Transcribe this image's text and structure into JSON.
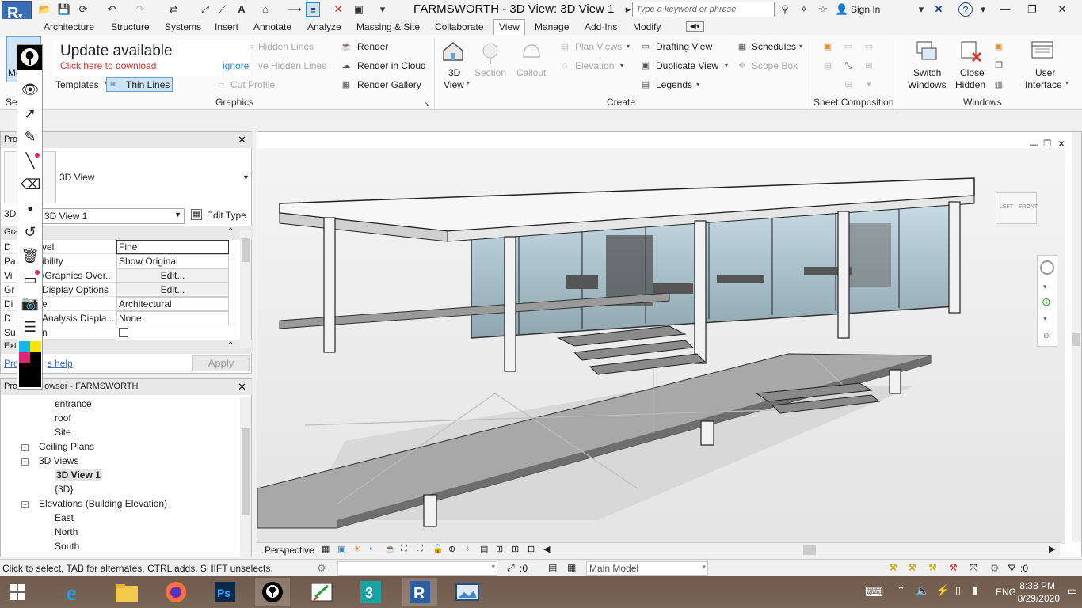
{
  "app": {
    "logo_letter": "R",
    "title": "FARMSWORTH - 3D View: 3D View 1",
    "search_placeholder": "Type a keyword or phrase",
    "sign_in": "Sign In"
  },
  "tabs": [
    {
      "label": "Architecture"
    },
    {
      "label": "Structure"
    },
    {
      "label": "Systems"
    },
    {
      "label": "Insert"
    },
    {
      "label": "Annotate"
    },
    {
      "label": "Analyze"
    },
    {
      "label": "Massing & Site"
    },
    {
      "label": "Collaborate"
    },
    {
      "label": "View"
    },
    {
      "label": "Manage"
    },
    {
      "label": "Add-Ins"
    },
    {
      "label": "Modify"
    }
  ],
  "ribbon": {
    "modify_label": "Modify",
    "select_label": "Se",
    "update_title": "Update available",
    "update_link": "Click here to download",
    "update_ignore": "ignore",
    "hidden_lines": "Hidden Lines",
    "remove_hidden_lines": "ve Hidden Lines",
    "templates": "Templates",
    "thin_lines": "Thin Lines",
    "cut_profile": "Cut Profile",
    "render": "Render",
    "render_cloud": "Render in Cloud",
    "render_gallery": "Render Gallery",
    "view_3d_line1": "3D",
    "view_3d_line2": "View",
    "section": "Section",
    "callout": "Callout",
    "plan_views": "Plan Views",
    "elevation": "Elevation",
    "drafting_view": "Drafting View",
    "duplicate_view": "Duplicate View",
    "legends": "Legends",
    "schedules": "Schedules",
    "scope_box": "Scope Box",
    "switch_windows_1": "Switch",
    "switch_windows_2": "Windows",
    "close_hidden_1": "Close",
    "close_hidden_2": "Hidden",
    "user_interface_1": "User",
    "user_interface_2": "Interface",
    "panel_graphics": "Graphics",
    "panel_create": "Create",
    "panel_sheet": "Sheet Composition",
    "panel_windows": "Windows"
  },
  "properties": {
    "header": "Pro",
    "type_name": "3D View",
    "instance_prefix": "3D",
    "instance_value": "3D View 1",
    "edit_type": "Edit Type",
    "group_graphics": "Gra",
    "group_extents": "Ext",
    "rows": [
      {
        "name_a": "D",
        "name_b": "vel",
        "value": "Fine",
        "type": "text"
      },
      {
        "name_a": "Pa",
        "name_b": "ibility",
        "value": "Show Original",
        "type": "text"
      },
      {
        "name_a": "Vi",
        "name_b": "/Graphics Over...",
        "value": "Edit...",
        "type": "button"
      },
      {
        "name_a": "Gr",
        "name_b": "Display Options",
        "value": "Edit...",
        "type": "button"
      },
      {
        "name_a": "Di",
        "name_b": "e",
        "value": "Architectural",
        "type": "text"
      },
      {
        "name_a": "D",
        "name_b": "Analysis Displa...",
        "value": "None",
        "type": "text"
      },
      {
        "name_a": "Su",
        "name_b": "n",
        "value": "",
        "type": "checkbox"
      }
    ],
    "help_a": "Pro",
    "help_b": "s help",
    "apply": "Apply"
  },
  "browser": {
    "header_a": "Pro",
    "header_b": "owser - FARMSWORTH",
    "items": [
      {
        "label": "entrance",
        "level": 2,
        "bold": false,
        "toggle": ""
      },
      {
        "label": "roof",
        "level": 2,
        "bold": false,
        "toggle": ""
      },
      {
        "label": "Site",
        "level": 2,
        "bold": false,
        "toggle": ""
      },
      {
        "label": "Ceiling Plans",
        "level": 1,
        "bold": false,
        "toggle": "+"
      },
      {
        "label": "3D Views",
        "level": 1,
        "bold": false,
        "toggle": "−"
      },
      {
        "label": "3D View 1",
        "level": 2,
        "bold": true,
        "toggle": ""
      },
      {
        "label": "{3D}",
        "level": 2,
        "bold": false,
        "toggle": ""
      },
      {
        "label": "Elevations (Building Elevation)",
        "level": 1,
        "bold": false,
        "toggle": "−"
      },
      {
        "label": "East",
        "level": 2,
        "bold": false,
        "toggle": ""
      },
      {
        "label": "North",
        "level": 2,
        "bold": false,
        "toggle": ""
      },
      {
        "label": "South",
        "level": 2,
        "bold": false,
        "toggle": ""
      }
    ]
  },
  "viewport": {
    "viewcube_left": "LEFT",
    "viewcube_front": "FRONT",
    "projection": "Perspective"
  },
  "status": {
    "hint": "Click to select, TAB for alternates, CTRL adds, SHIFT unselects.",
    "selection_count": ":0",
    "model": "Main Model",
    "filter_count": ":0"
  },
  "taskbar": {
    "time": "8:38 PM",
    "date": "8/29/2020",
    "language": "ENG",
    "apps": [
      "start",
      "internet-explorer",
      "file-explorer",
      "firefox",
      "photoshop",
      "drawing-tool",
      "whiteboard",
      "3ds-max",
      "revit",
      "image-viewer"
    ]
  }
}
